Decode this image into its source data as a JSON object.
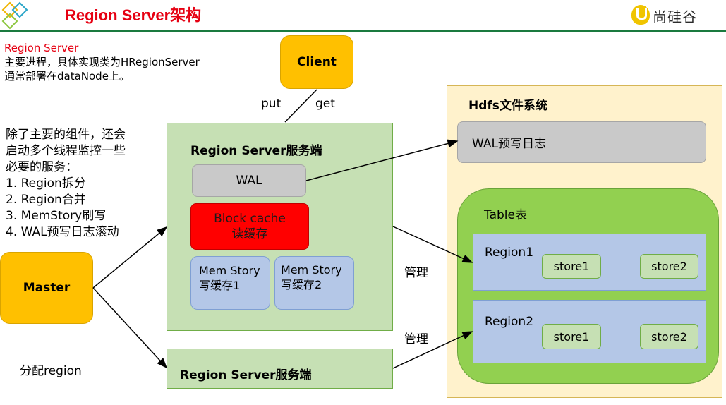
{
  "header": {
    "title": "Region Server架构",
    "logo_text": "尚硅谷"
  },
  "intro": {
    "heading": "Region Server",
    "line1": "主要进程，具体实现类为HRegionServer",
    "line2": "通常部署在dataNode上。"
  },
  "side_notes": {
    "lead1": "除了主要的组件，还会",
    "lead2": "启动多个线程监控一些",
    "lead3": "必要的服务：",
    "items": [
      "1.  Region拆分",
      "2.  Region合并",
      "3.  MemStory刷写",
      "4.  WAL预写日志滚动"
    ]
  },
  "client": {
    "label": "Client",
    "put": "put",
    "get": "get"
  },
  "master": {
    "label": "Master",
    "assign": "分配region"
  },
  "region_server_main": {
    "label": "Region Server服务端",
    "wal": "WAL",
    "block_cache_1": "Block cache",
    "block_cache_2": "读缓存",
    "memstore1_1": "Mem Story",
    "memstore1_2": "写缓存1",
    "memstore2_1": "Mem Story",
    "memstore2_2": "写缓存2"
  },
  "region_server_second": {
    "label": "Region Server服务端"
  },
  "manage_labels": [
    "管理",
    "管理"
  ],
  "hdfs": {
    "label": "Hdfs文件系统",
    "wal_log": "WAL预写日志",
    "table": "Table表",
    "region1": {
      "label": "Region1",
      "store1": "store1",
      "store2": "store2"
    },
    "region2": {
      "label": "Region2",
      "store1": "store1",
      "store2": "store2"
    }
  },
  "colors": {
    "title_red": "#e60012",
    "header_green": "#1a7a3f",
    "orange": "#ffc000",
    "light_green": "#c6e0b4",
    "bright_green": "#92d050",
    "hdfs_bg": "#fff2cc",
    "blue": "#b4c7e7",
    "gray": "#c9c9c9",
    "red": "#ff0000"
  }
}
